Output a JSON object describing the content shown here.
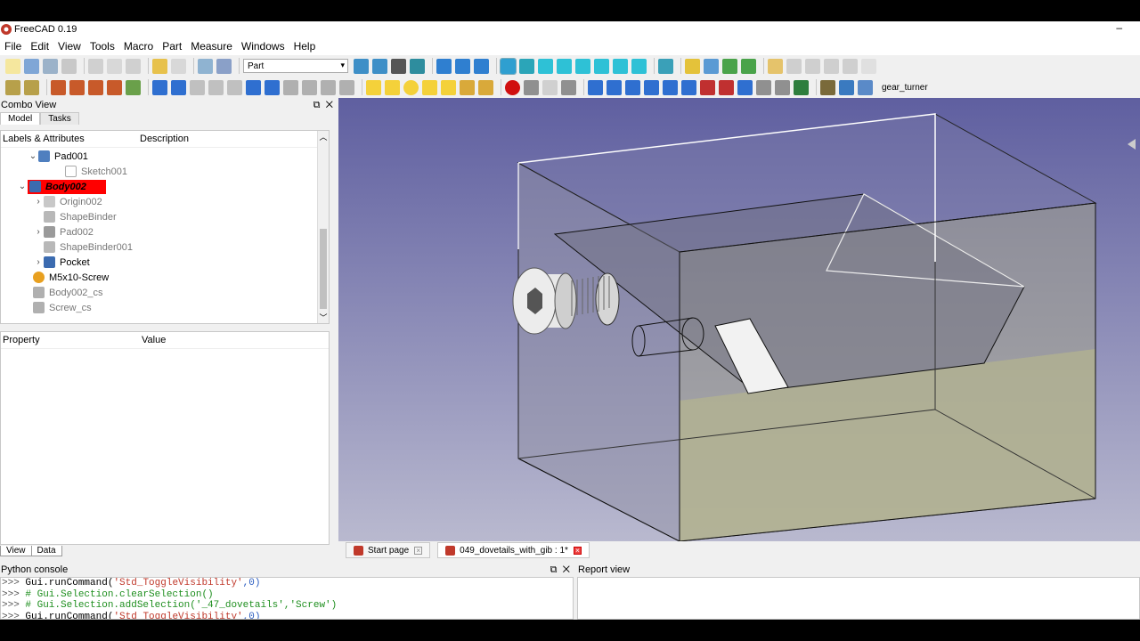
{
  "app": {
    "title": "FreeCAD 0.19",
    "minimize_glyph": "–"
  },
  "menu": [
    "File",
    "Edit",
    "View",
    "Tools",
    "Macro",
    "Part",
    "Measure",
    "Windows",
    "Help"
  ],
  "toolbar": {
    "workbench": "Part",
    "gear_label": "gear_turner"
  },
  "combo": {
    "title": "Combo View",
    "tabs": [
      "Model",
      "Tasks"
    ],
    "columns": {
      "labels": "Labels & Attributes",
      "description": "Description"
    },
    "tree": [
      {
        "label": "Pad001"
      },
      {
        "label": "Sketch001"
      },
      {
        "label": "Body002"
      },
      {
        "label": "Origin002"
      },
      {
        "label": "ShapeBinder"
      },
      {
        "label": "Pad002"
      },
      {
        "label": "ShapeBinder001"
      },
      {
        "label": "Pocket"
      },
      {
        "label": "M5x10-Screw"
      },
      {
        "label": "Body002_cs"
      },
      {
        "label": "Screw_cs"
      }
    ],
    "property_columns": {
      "property": "Property",
      "value": "Value"
    },
    "bottom_tabs": [
      "View",
      "Data"
    ]
  },
  "doctabs": [
    {
      "label": "Start page"
    },
    {
      "label": "049_dovetails_with_gib : 1*"
    }
  ],
  "python_console": {
    "title": "Python console",
    "lines": [
      {
        "prompt": ">>> ",
        "code": "Gui.runCommand(",
        "str": "'Std_ToggleVisibility'",
        "num": ",0)",
        "comment": false
      },
      {
        "prompt": ">>> ",
        "code": "# Gui.Selection.clearSelection()",
        "str": "",
        "num": "",
        "comment": true
      },
      {
        "prompt": ">>> ",
        "code": "# Gui.Selection.addSelection('_47_dovetails','Screw')",
        "str": "",
        "num": "",
        "comment": true
      },
      {
        "prompt": ">>> ",
        "code": "Gui.runCommand(",
        "str": "'Std_ToggleVisibility'",
        "num": ",0)",
        "comment": false
      }
    ]
  },
  "report_view": {
    "title": "Report view"
  },
  "colors": {
    "selection": "#ff0000",
    "viewport_top": "#5f5fa0",
    "viewport_bottom": "#b9b9cf"
  }
}
